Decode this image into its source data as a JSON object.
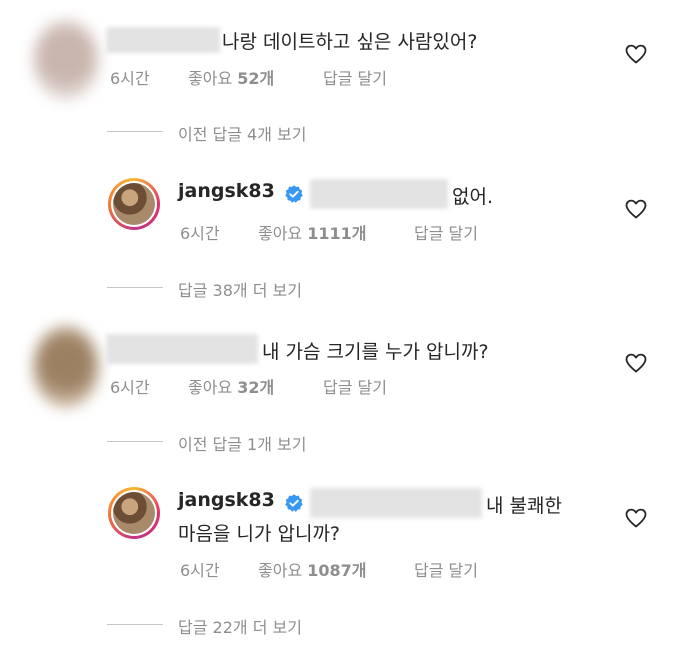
{
  "threads": [
    {
      "comment": {
        "text": "나랑 데이트하고 싶은 사람있어?",
        "time": "6시간",
        "likes_label": "좋아요",
        "likes_count": "52개",
        "reply_label": "답글 달기"
      },
      "view_prev": "이전 답글 4개 보기",
      "reply": {
        "username": "jangsk83",
        "text": "없어.",
        "time": "6시간",
        "likes_label": "좋아요",
        "likes_count": "1111개",
        "reply_label": "답글 달기"
      },
      "view_more": "답글 38개 더 보기"
    },
    {
      "comment": {
        "text": "내 가슴 크기를 누가 압니까?",
        "time": "6시간",
        "likes_label": "좋아요",
        "likes_count": "32개",
        "reply_label": "답글 달기"
      },
      "view_prev": "이전 답글 1개 보기",
      "reply": {
        "username": "jangsk83",
        "text_line1": "내 불쾌한",
        "text_line2": "마음을 니가 압니까?",
        "time": "6시간",
        "likes_label": "좋아요",
        "likes_count": "1087개",
        "reply_label": "답글 달기"
      },
      "view_more": "답글 22개 더 보기"
    }
  ],
  "icons": {
    "heart": "heart-outline-icon",
    "verified": "verified-badge-icon"
  },
  "colors": {
    "text": "#262626",
    "meta": "#8e8e8e",
    "verified": "#3897f0"
  }
}
